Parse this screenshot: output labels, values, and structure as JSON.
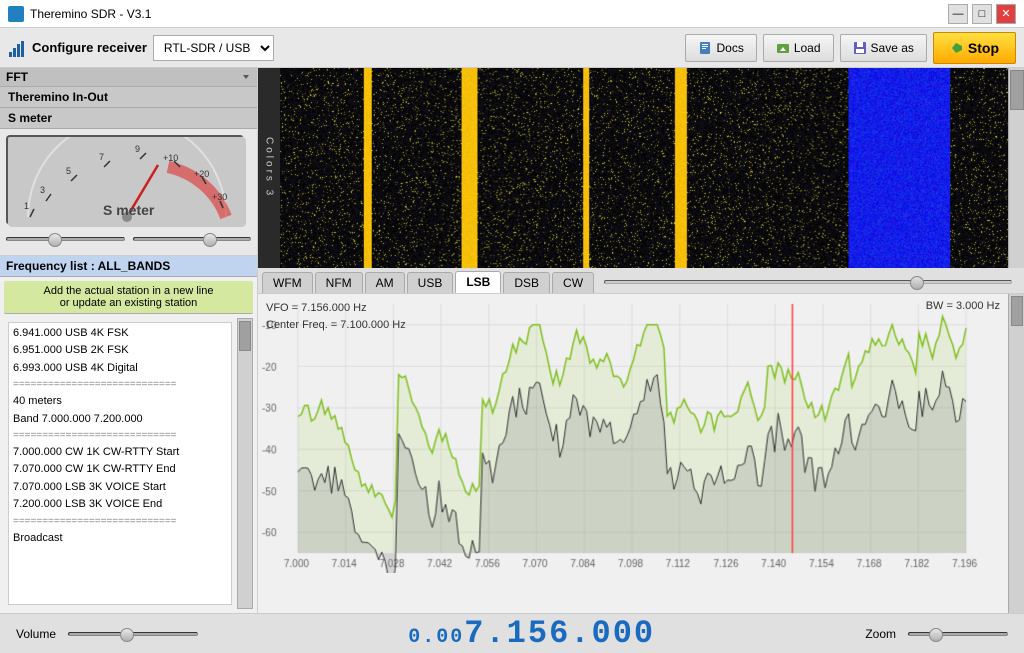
{
  "app": {
    "title": "Theremino SDR - V3.1",
    "icon": "spectrum-icon"
  },
  "titlebar": {
    "minimize_label": "—",
    "maximize_label": "□",
    "close_label": "✕"
  },
  "toolbar": {
    "configure_label": "Configure receiver",
    "receiver_options": [
      "RTL-SDR / USB"
    ],
    "receiver_selected": "RTL-SDR / USB",
    "docs_label": "Docs",
    "load_label": "Load",
    "save_as_label": "Save as",
    "stop_label": "Stop"
  },
  "left_panel": {
    "fft_label": "FFT",
    "theremino_inout_label": "Theremino In-Out",
    "smeter_label": "S meter",
    "smeter_title": "S meter",
    "freq_list_label": "Frequency list : ALL_BANDS",
    "freq_list_hint_line1": "Add the actual station in a new line",
    "freq_list_hint_line2": "or update an existing station",
    "freq_list_items": [
      "6.941.000 USB 4K FSK",
      "6.951.000 USB 2K FSK",
      "6.993.000 USB 4K Digital",
      "============================",
      "40 meters",
      "Band 7.000.000 7.200.000",
      "============================",
      "7.000.000 CW 1K CW-RTTY Start",
      "7.070.000 CW 1K CW-RTTY End",
      "7.070.000 LSB 3K VOICE Start",
      "7.200.000 LSB 3K VOICE End",
      "============================",
      "Broadcast"
    ]
  },
  "waterfall": {
    "colors_label": "C\no\nl\no\nr\ns\n\n3"
  },
  "mode_tabs": {
    "tabs": [
      "WFM",
      "NFM",
      "AM",
      "USB",
      "LSB",
      "DSB",
      "CW"
    ],
    "active": "LSB"
  },
  "spectrum": {
    "vfo_label": "VFO = 7.156.000 Hz",
    "center_freq_label": "Center Freq. = 7.100.000 Hz",
    "bw_label": "BW = 3.000 Hz",
    "freq_markers": [
      "7.000",
      "7.014",
      "7.028",
      "7.042",
      "7.056",
      "7.070",
      "7.084",
      "7.098",
      "7.112",
      "7.126",
      "7.140",
      "7.154",
      "7.168",
      "7.182",
      "7.196"
    ],
    "db_markers": [
      "-10",
      "-20",
      "-30",
      "-40",
      "-50",
      "-60"
    ],
    "vfo_line_position": 0.74
  },
  "bottom_bar": {
    "volume_label": "Volume",
    "zoom_label": "Zoom",
    "frequency_display": "0.007.156.000",
    "freq_prefix": "0.00",
    "freq_main": "7.156.000"
  }
}
